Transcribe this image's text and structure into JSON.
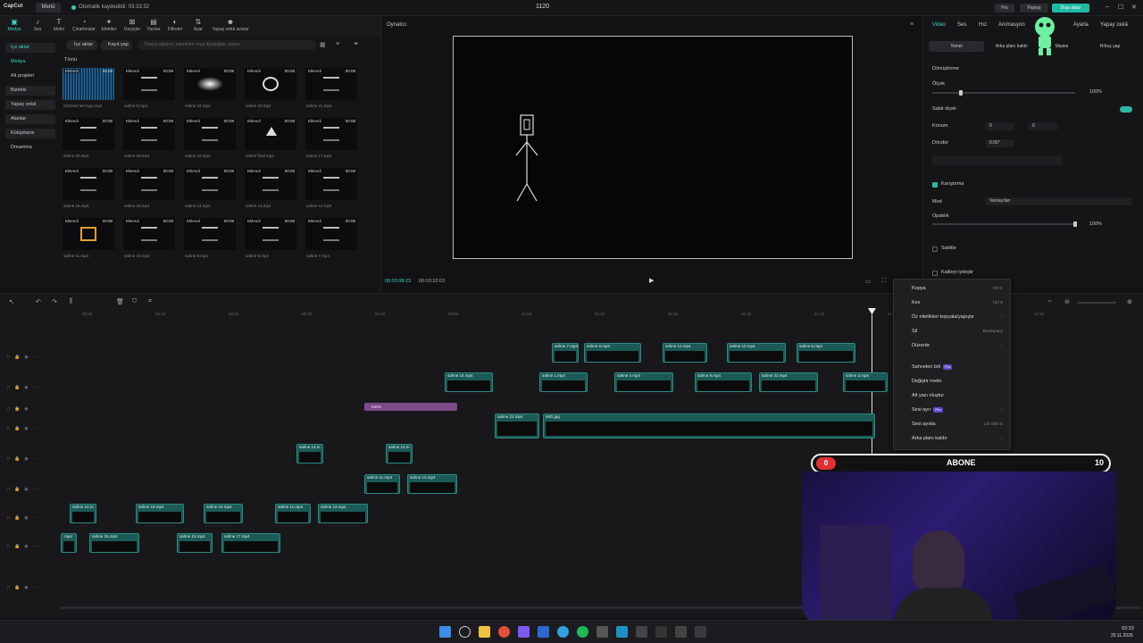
{
  "titlebar": {
    "logo": "CapCut",
    "menu": "Menü",
    "status": "Otomatik kaydedildi: 03:33:32",
    "title": "1120",
    "pro": "Pro",
    "share": "Paylaş",
    "export": "Dışa aktar"
  },
  "toolbar": [
    "Medya",
    "Ses",
    "Metin",
    "Çıkartmalar",
    "Efektler",
    "Geçişler",
    "Yazılar",
    "Filtreler",
    "Ayar",
    "Yapay zekâ avatar"
  ],
  "sidebar": {
    "import": "İçe aktar",
    "items": [
      "Medya",
      "Alt projeler",
      "Bizimki",
      "Yapay zekâ",
      "Alanlar",
      "Kütüphane",
      "Dreamina"
    ]
  },
  "media": {
    "import_btn": "İçe aktar",
    "record_btn": "Kayıt yap",
    "search_placeholder": "Dosya adlarını, sahneleri veya diyalogları arayın",
    "all_label": "Tümü",
    "added_label": "Eklendi",
    "thumbs": [
      {
        "name": "Glitched led logo.mp4",
        "dur": "00:08"
      },
      {
        "name": "sahne 8.mp4",
        "dur": "00:08"
      },
      {
        "name": "sahne 23.mp4",
        "dur": "00:08"
      },
      {
        "name": "sahne 22.mp4",
        "dur": "00:08"
      },
      {
        "name": "sahne 21.mp4",
        "dur": "00:08"
      },
      {
        "name": "sahne 20.mp4",
        "dur": "00:08"
      },
      {
        "name": "sahne 19.mp4",
        "dur": "00:08"
      },
      {
        "name": "sahne 18.mp4",
        "dur": "00:08"
      },
      {
        "name": "sahne final.mp4",
        "dur": "00:08"
      },
      {
        "name": "sahne 17.mp4",
        "dur": "00:08"
      },
      {
        "name": "sahne 16.mp4",
        "dur": "00:08"
      },
      {
        "name": "sahne 15.mp4",
        "dur": "00:08"
      },
      {
        "name": "sahne 14.mp4",
        "dur": "00:08"
      },
      {
        "name": "sahne 13.mp4",
        "dur": "00:08"
      },
      {
        "name": "sahne 12.mp4",
        "dur": "00:08"
      },
      {
        "name": "sahne 11.mp4",
        "dur": "00:08"
      },
      {
        "name": "sahne 10.mp4",
        "dur": "00:08"
      },
      {
        "name": "sahne 9.mp4",
        "dur": "00:08"
      },
      {
        "name": "sahne 8.mp4",
        "dur": "00:08"
      },
      {
        "name": "sahne 7.mp4",
        "dur": "00:08"
      }
    ]
  },
  "player": {
    "title": "Oynatıcı",
    "current_time": "00:03:08:23",
    "total_time": "00:03:32:03"
  },
  "props": {
    "tabs": [
      "Video",
      "Ses",
      "Hız",
      "Animasyon",
      "Ayarla",
      "Yapay zekâ"
    ],
    "subtabs": [
      "Temel",
      "Arka planı kaldır",
      "Maske",
      "Rötuş yap"
    ],
    "transform": "Dönüştürme",
    "scale": "Ölçek",
    "scale_value": "100%",
    "uniform_scale": "Sabit ölçek",
    "position": "Konum",
    "pos_x": "0",
    "pos_y": "0",
    "rotate": "Döndür",
    "rotate_value": "0.00°",
    "blend": "Karıştırma",
    "mode": "Mod",
    "mode_value": "Varsayılan",
    "opacity": "Opaklık",
    "opacity_value": "100%",
    "stabilize": "Sabitle",
    "enhance": "Kaliteyi iyileştir"
  },
  "context_menu": [
    {
      "label": "Kopya",
      "shortcut": "Ctrl C"
    },
    {
      "label": "Kes",
      "shortcut": "Ctrl X"
    },
    {
      "label": "Öz nitelikleri kopyala/yapıştır",
      "shortcut": "›"
    },
    {
      "label": "Sil",
      "shortcut": "Backspace"
    },
    {
      "label": "Düzenle",
      "shortcut": "›"
    },
    {
      "label": "Sahneleri böl",
      "shortcut": "",
      "badge": "Pro"
    },
    {
      "label": "Değiştir metin",
      "shortcut": ""
    },
    {
      "label": "Alt yazı oluştur",
      "shortcut": ""
    },
    {
      "label": "Sesi ayır",
      "shortcut": "›",
      "badge": "Pro"
    },
    {
      "label": "Sesi ayıkla",
      "shortcut": "Ctrl Shift S"
    },
    {
      "label": "Arka planı kaldır",
      "shortcut": "›"
    }
  ],
  "timeline": {
    "ruler": [
      "00:00",
      "00:10",
      "00:20",
      "00:30",
      "00:40",
      "00:50",
      "01:00",
      "01:10",
      "01:20",
      "01:30",
      "01:40",
      "01:50",
      "02:00",
      "02:10"
    ],
    "text_clip": "Metin",
    "clips_row1": [
      "sahne 7.mp4",
      "sahne 9.mp4",
      "sahne 12.mp4",
      "sahne 10.mp4",
      "sahne 5.mp4"
    ],
    "clips_row2": [
      "sahne 14.mp4",
      "sahne 1.mp4",
      "sahne 4.mp4",
      "sahne 8.mp4",
      "sahne 22.mp4",
      "sahne 3.mp4"
    ],
    "main_clip": "sahne 23.mp4",
    "main_clip2": "IMG.jpg",
    "clips_row5": [
      "sahne 12.m",
      "sahne 12.m"
    ],
    "clips_row6": [
      "sahne 11.mp4",
      "sahne 13.mp4"
    ],
    "clips_row7": [
      "sahne 12.m",
      "sahne 19.mp4",
      "sahne 16.mp4",
      "sahne 11.mp4",
      "sahne 13.mp4"
    ],
    "clips_row8": [
      ".mp4",
      "sahne 15.mp4",
      "sahne 15.mp4",
      "sahne 17.mp4"
    ]
  },
  "subscribe": {
    "left": "0",
    "text": "ABONE",
    "right": "10"
  },
  "clock": {
    "time": "03:33",
    "date": "20.11.2025"
  }
}
